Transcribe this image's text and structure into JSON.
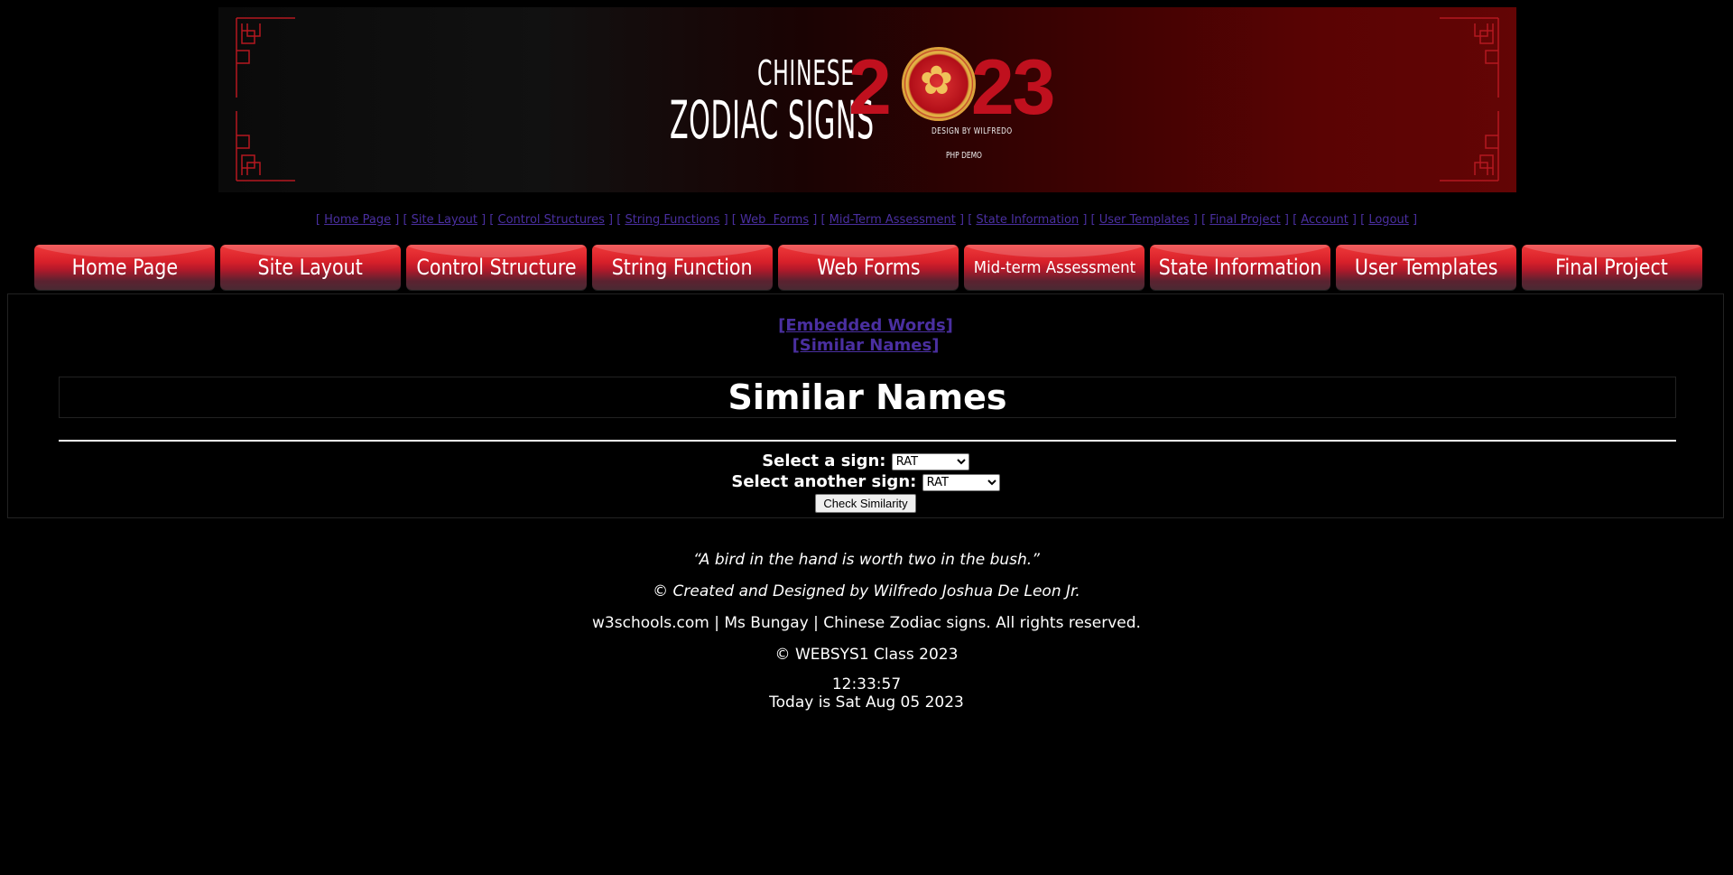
{
  "banner": {
    "title_line1": "CHINESE",
    "title_line2": "ZODIAC SIGNS",
    "year_2": "2",
    "year_rest": "23",
    "credit": "DESIGN BY WILFREDO",
    "demo": "PHP DEMO"
  },
  "text_nav": [
    "Home Page",
    "Site Layout",
    "Control Structures",
    "String Functions",
    "Web  Forms",
    "Mid-Term Assessment",
    "State Information",
    "User Templates",
    "Final Project",
    "Account",
    "Logout"
  ],
  "button_nav": [
    "Home Page",
    "Site Layout",
    "Control Structure",
    "String Function",
    "Web Forms",
    "Mid-term Assessment",
    "State Information",
    "User Templates",
    "Final Project"
  ],
  "sublinks": {
    "embedded": "[Embedded Words]",
    "similar": "[Similar Names]"
  },
  "page_title": "Similar Names",
  "form": {
    "label1": "Select a sign:",
    "select1_value": "RAT",
    "label2": "Select another sign:",
    "select2_value": "RAT",
    "submit_label": "Check Similarity"
  },
  "footer": {
    "quote": "“A bird in the hand is worth two in the bush.”",
    "created": "© Created and Designed by Wilfredo Joshua De Leon Jr.",
    "credits": "w3schools.com | Ms Bungay | Chinese Zodiac signs. All rights reserved.",
    "class": "© WEBSYS1 Class 2023",
    "time": "12:33:57",
    "date": "Today is Sat Aug 05 2023"
  },
  "colors": {
    "background": "#000000",
    "link": "#4a2fa0",
    "button_red": "#d8202a",
    "year_red": "#c0101e"
  }
}
